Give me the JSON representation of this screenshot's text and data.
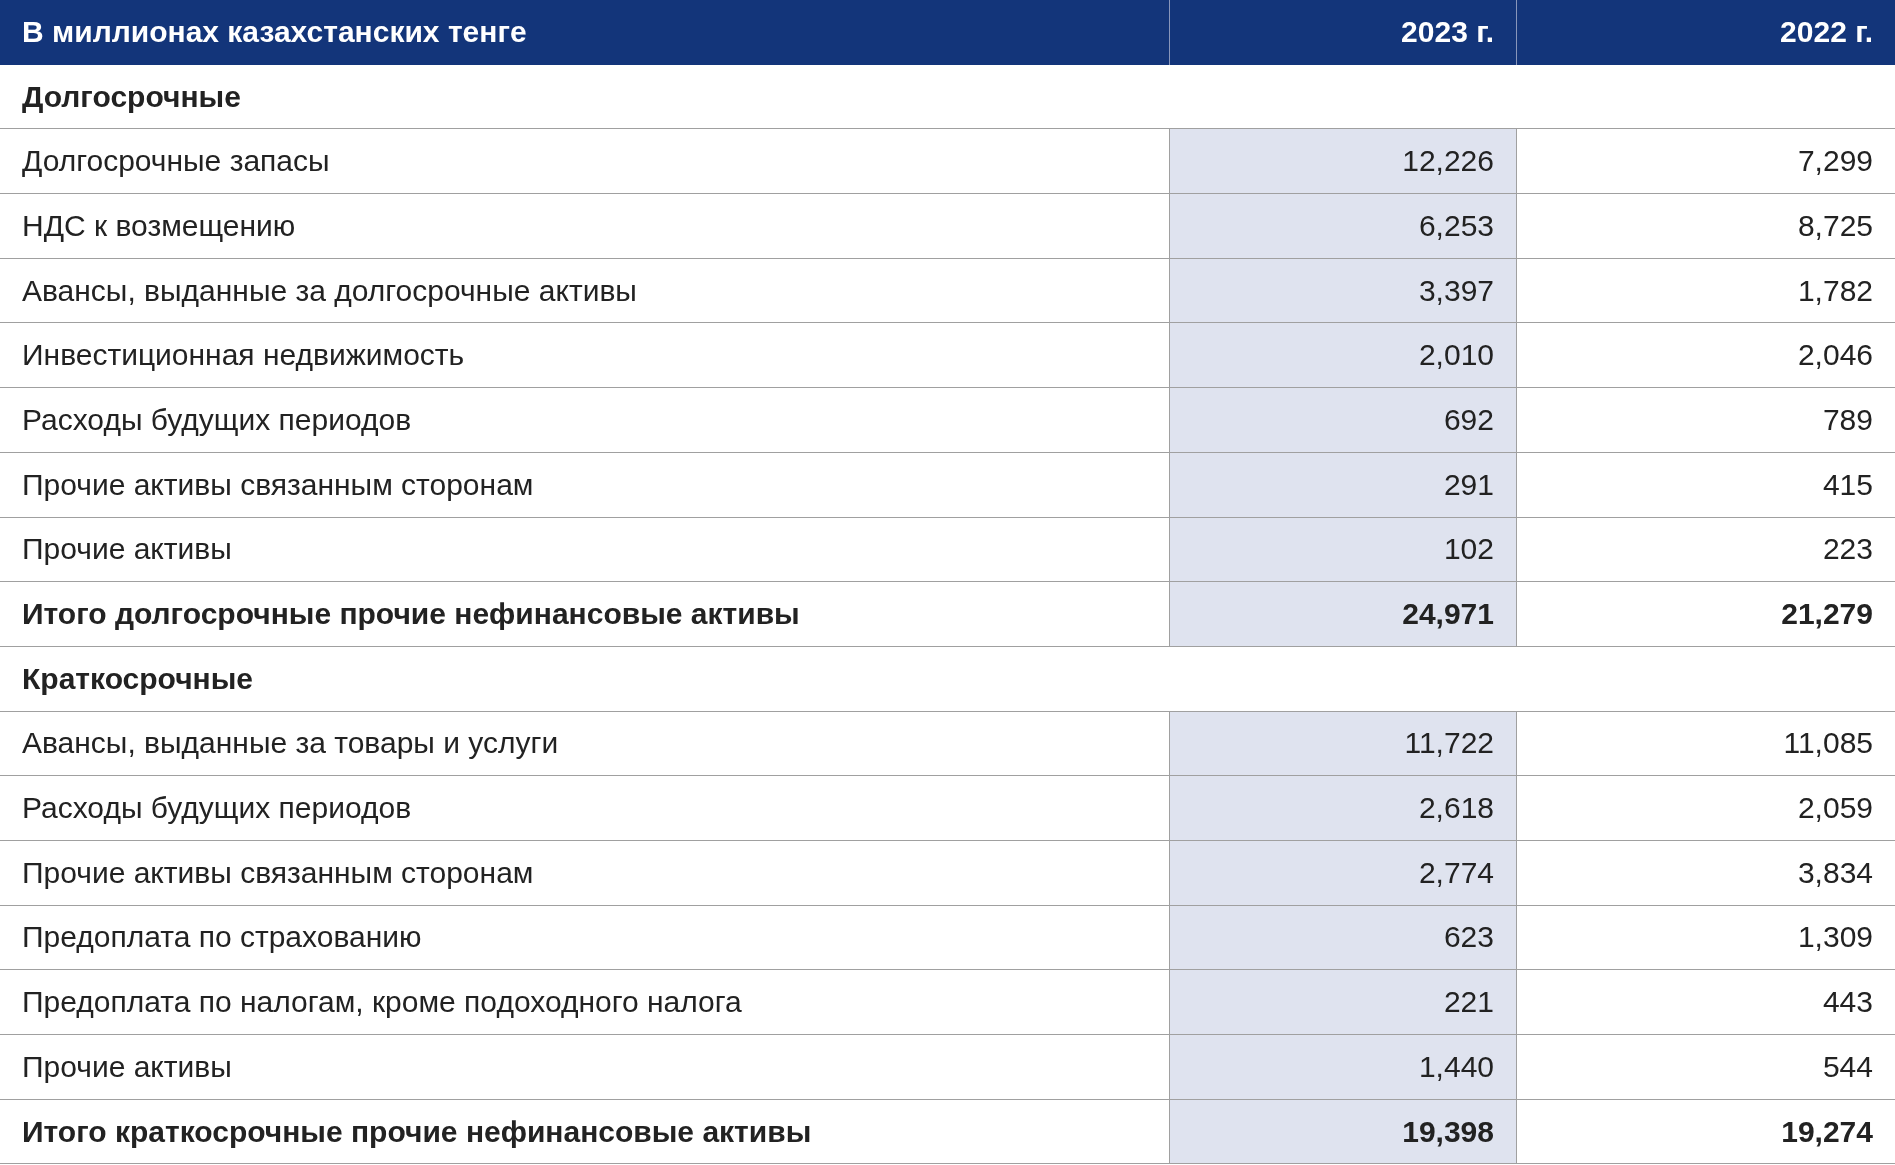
{
  "table": {
    "columns": [
      "В миллионах казахстанских тенге",
      "2023 г.",
      "2022 г."
    ],
    "rows": [
      {
        "kind": "section",
        "label": "Долгосрочные"
      },
      {
        "kind": "item",
        "label": "Долгосрочные запасы",
        "values": [
          "12,226",
          "7,299"
        ]
      },
      {
        "kind": "item",
        "label": "НДС к возмещению",
        "values": [
          "6,253",
          "8,725"
        ]
      },
      {
        "kind": "item",
        "label": "Авансы, выданные за долгосрочные активы",
        "values": [
          "3,397",
          "1,782"
        ]
      },
      {
        "kind": "item",
        "label": "Инвестиционная недвижимость",
        "values": [
          "2,010",
          "2,046"
        ]
      },
      {
        "kind": "item",
        "label": "Расходы будущих периодов",
        "values": [
          "692",
          "789"
        ]
      },
      {
        "kind": "item",
        "label": "Прочие активы связанным сторонам",
        "values": [
          "291",
          "415"
        ]
      },
      {
        "kind": "item",
        "label": "Прочие активы",
        "values": [
          "102",
          "223"
        ]
      },
      {
        "kind": "total",
        "label": "Итого долгосрочные прочие нефинансовые активы",
        "values": [
          "24,971",
          "21,279"
        ]
      },
      {
        "kind": "section",
        "label": "Краткосрочные"
      },
      {
        "kind": "item",
        "label": "Авансы, выданные за товары и услуги",
        "values": [
          "11,722",
          "11,085"
        ]
      },
      {
        "kind": "item",
        "label": "Расходы будущих периодов",
        "values": [
          "2,618",
          "2,059"
        ]
      },
      {
        "kind": "item",
        "label": "Прочие активы связанным сторонам",
        "values": [
          "2,774",
          "3,834"
        ]
      },
      {
        "kind": "item",
        "label": "Предоплата по страхованию",
        "values": [
          "623",
          "1,309"
        ]
      },
      {
        "kind": "item",
        "label": "Предоплата по налогам, кроме подоходного налога",
        "values": [
          "221",
          "443"
        ]
      },
      {
        "kind": "item",
        "label": "Прочие активы",
        "values": [
          "1,440",
          "544"
        ]
      },
      {
        "kind": "total",
        "label": "Итого краткосрочные прочие нефинансовые активы",
        "values": [
          "19,398",
          "19,274"
        ]
      }
    ]
  }
}
